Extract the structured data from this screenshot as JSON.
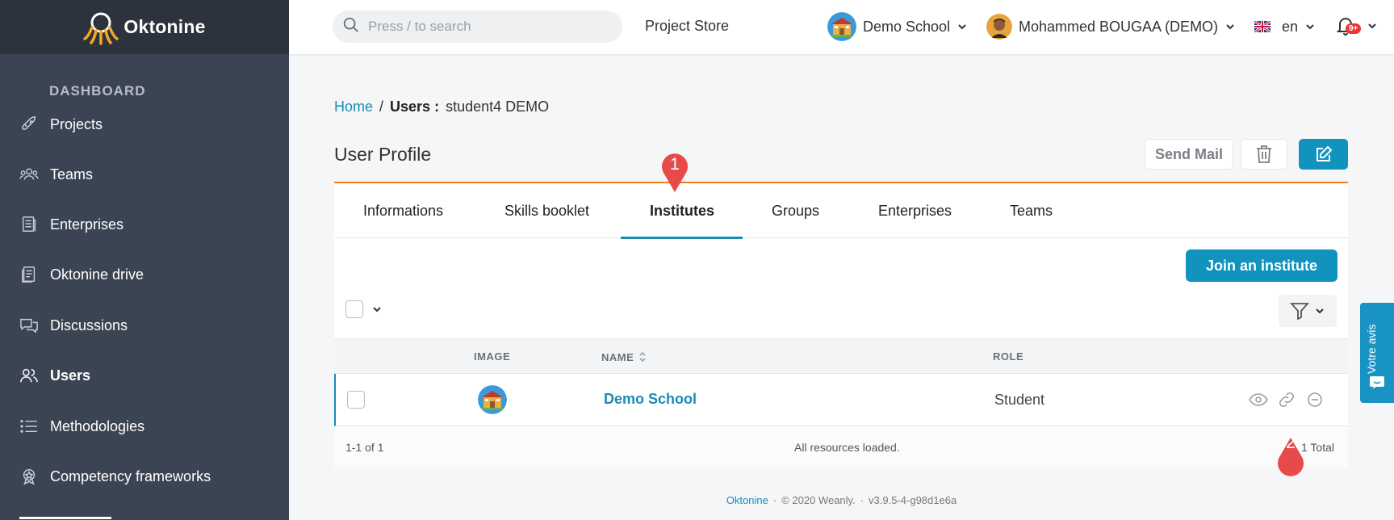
{
  "brand": {
    "name": "Oktonine"
  },
  "sidebar": {
    "heading": "DASHBOARD",
    "items": [
      {
        "label": "Projects",
        "icon": "rocket-icon"
      },
      {
        "label": "Teams",
        "icon": "team-icon"
      },
      {
        "label": "Enterprises",
        "icon": "enterprise-icon"
      },
      {
        "label": "Oktonine drive",
        "icon": "drive-icon"
      },
      {
        "label": "Discussions",
        "icon": "discussion-icon"
      },
      {
        "label": "Users",
        "icon": "users-icon",
        "active": true
      },
      {
        "label": "Methodologies",
        "icon": "list-icon"
      },
      {
        "label": "Competency frameworks",
        "icon": "competency-icon"
      }
    ]
  },
  "topbar": {
    "search_placeholder": "Press / to search",
    "project_store": "Project Store",
    "school": "Demo School",
    "user": "Mohammed BOUGAA (DEMO)",
    "language": "en",
    "notifications_badge": "9+"
  },
  "breadcrumb": {
    "home": "Home",
    "separator": "/",
    "users": "Users :",
    "current": "student4 DEMO"
  },
  "page": {
    "title": "User Profile",
    "send_mail": "Send Mail"
  },
  "tabs": [
    {
      "label": "Informations"
    },
    {
      "label": "Skills booklet"
    },
    {
      "label": "Institutes",
      "active": true
    },
    {
      "label": "Groups"
    },
    {
      "label": "Enterprises"
    },
    {
      "label": "Teams"
    }
  ],
  "institutes": {
    "join_button": "Join an institute",
    "columns": {
      "image": "IMAGE",
      "name": "NAME",
      "role": "ROLE"
    },
    "rows": [
      {
        "name": "Demo School",
        "role": "Student"
      }
    ],
    "footer": {
      "range": "1-1 of 1",
      "status": "All resources loaded.",
      "total": "1 Total"
    }
  },
  "markers": {
    "first": "1",
    "second": "2"
  },
  "footer": {
    "brand": "Oktonine",
    "copyright": "© 2020 Weanly.",
    "version": "v3.9.5-4-g98d1e6a"
  },
  "feedback": {
    "label": "Votre avis"
  },
  "colors": {
    "accent": "#1193bd",
    "sidebar": "#3b4452",
    "orange": "#f07c22",
    "marker": "#e53935"
  }
}
